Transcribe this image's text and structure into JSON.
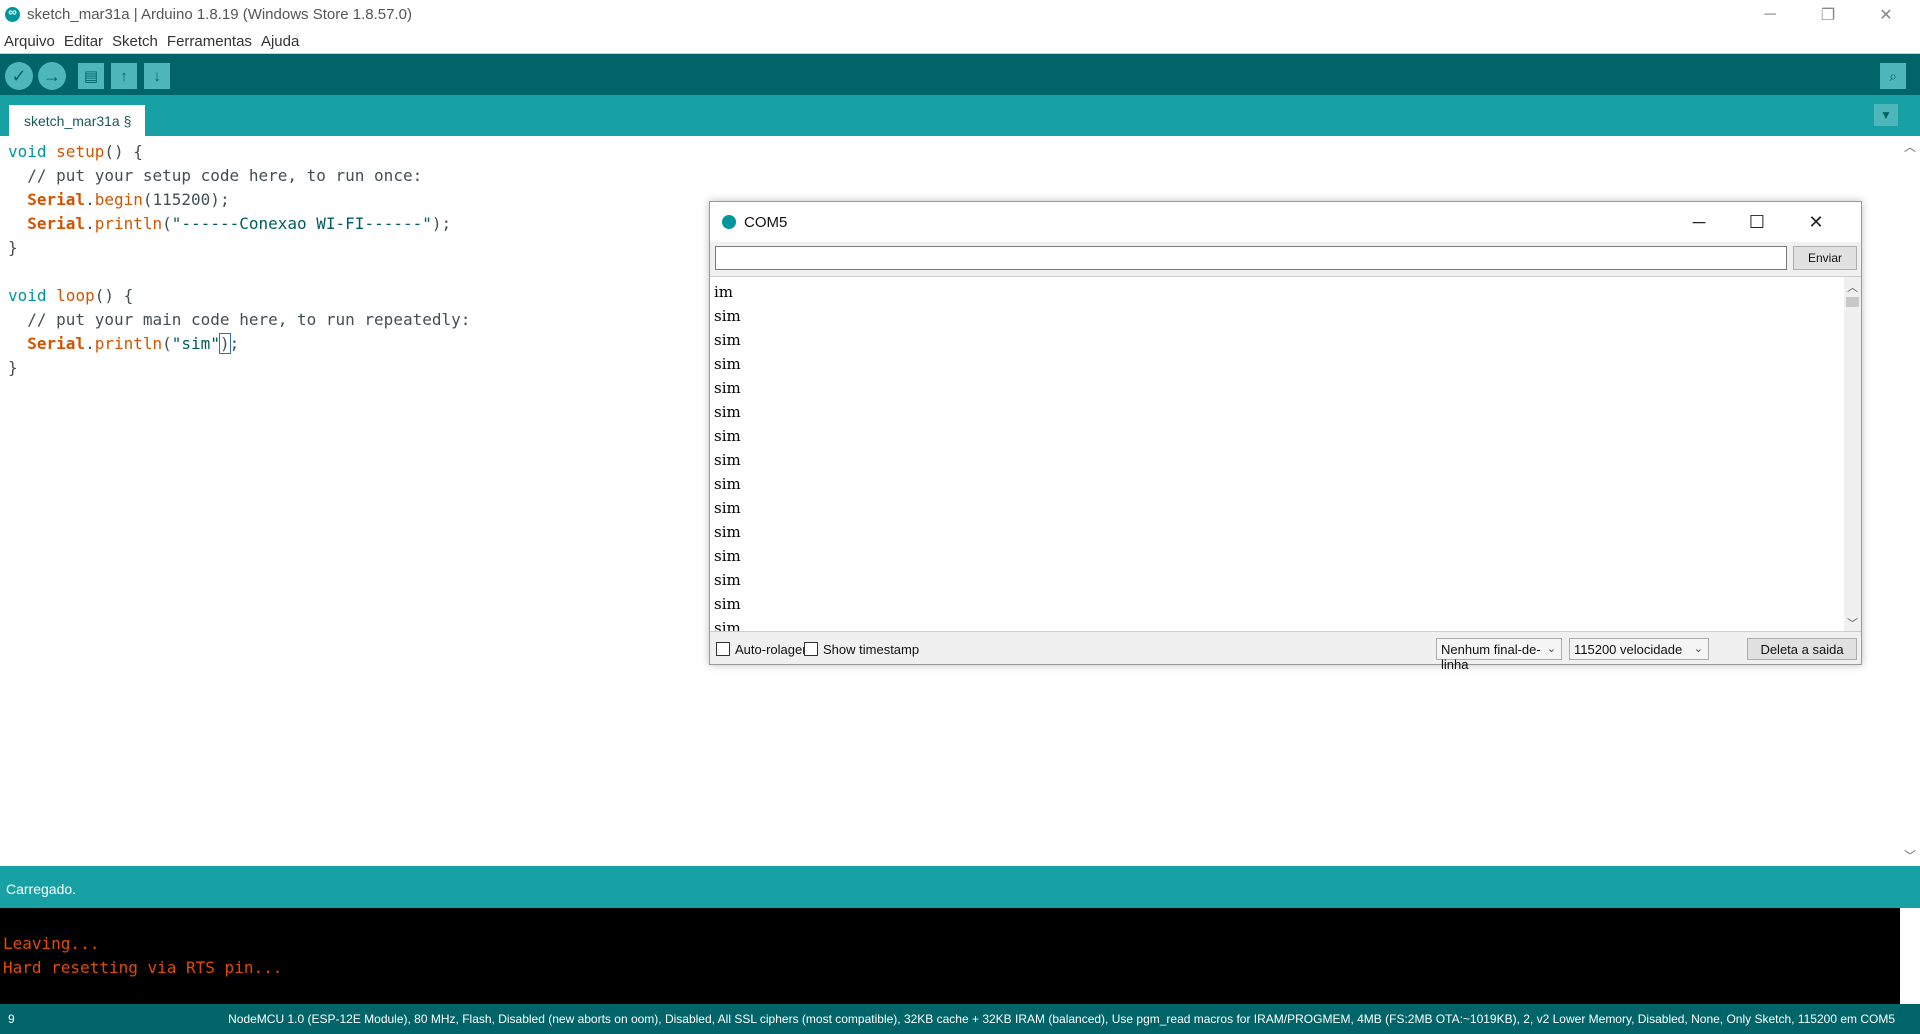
{
  "window": {
    "title": "sketch_mar31a | Arduino 1.8.19 (Windows Store 1.8.57.0)",
    "minimize": "─",
    "maximize": "❐",
    "close": "✕"
  },
  "menu": [
    "Arquivo",
    "Editar",
    "Sketch",
    "Ferramentas",
    "Ajuda"
  ],
  "toolbar": {
    "verify_icon": "✓",
    "upload_icon": "→",
    "new_icon": "▤",
    "open_icon": "↑",
    "save_icon": "↓",
    "serial_icon": "⌕"
  },
  "tab": {
    "label": "sketch_mar31a §",
    "menu_icon": "▼"
  },
  "code": {
    "l1_void": "void",
    "l1_fn": "setup",
    "l1_rest": "() {",
    "l2": "  // put your setup code here, to run once:",
    "l3_serial": "Serial",
    "l3_fn": "begin",
    "l3_rest": "(115200);",
    "l4_serial": "Serial",
    "l4_fn": "println",
    "l4_str": "\"------Conexao WI-FI------\"",
    "l4_rest": ");",
    "l5": "}",
    "l7_void": "void",
    "l7_fn": "loop",
    "l7_rest": "() {",
    "l8": "  // put your main code here, to run repeatedly:",
    "l9_serial": "Serial",
    "l9_fn": "println",
    "l9_str": "\"sim\"",
    "l9_cur": ")",
    "l9_rest": ";",
    "l10": "}"
  },
  "status": {
    "message": "Carregado."
  },
  "console": {
    "lines": [
      "Leaving...",
      "Hard resetting via RTS pin..."
    ]
  },
  "footer": {
    "line_number": "9",
    "board_info": "NodeMCU 1.0 (ESP-12E Module), 80 MHz, Flash, Disabled (new aborts on oom), Disabled, All SSL ciphers (most compatible), 32KB cache + 32KB IRAM (balanced), Use pgm_read macros for IRAM/PROGMEM, 4MB (FS:2MB OTA:~1019KB), 2, v2 Lower Memory, Disabled, None, Only Sketch, 115200 em COM5"
  },
  "serial_monitor": {
    "title": "COM5",
    "input_value": "",
    "send_label": "Enviar",
    "output": [
      "im",
      "sim",
      "sim",
      "sim",
      "sim",
      "sim",
      "sim",
      "sim",
      "sim",
      "sim",
      "sim",
      "sim",
      "sim",
      "sim",
      "sim"
    ],
    "autoscroll_label": "Auto-rolagem",
    "autoscroll_checked": false,
    "timestamp_label": "Show timestamp",
    "timestamp_checked": false,
    "line_ending": "Nenhum final-de-linha",
    "baud_rate": "115200 velocidade",
    "clear_label": "Deleta a saida",
    "minimize": "─",
    "maximize": "☐",
    "close": "✕"
  },
  "colors": {
    "toolbar": "#006468",
    "tabbar": "#17a1a5",
    "console_text": "#e34c00",
    "keyword": "#d35400",
    "type": "#00979c"
  }
}
